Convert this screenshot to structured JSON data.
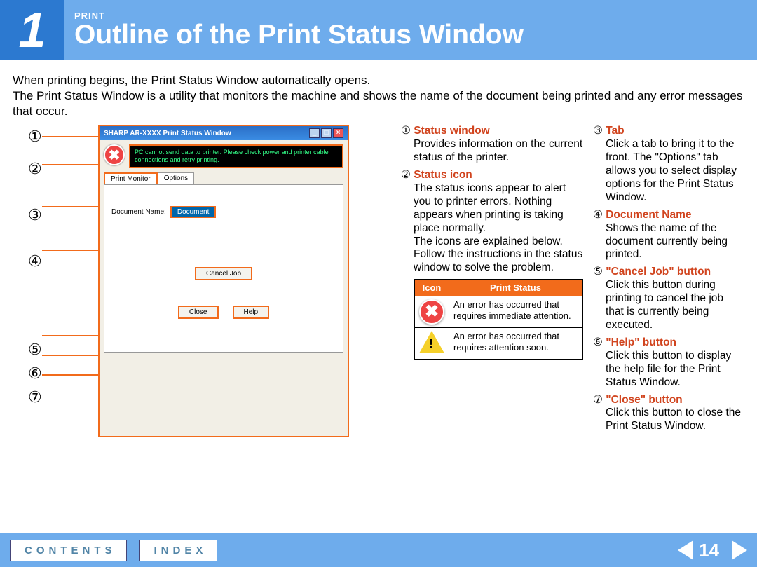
{
  "header": {
    "number": "1",
    "category": "PRINT",
    "title": "Outline of the Print Status Window"
  },
  "intro": "When printing begins, the Print Status Window automatically opens.\nThe Print Status Window is a utility that monitors the machine and shows the name of the document being printed and any error messages that occur.",
  "figure": {
    "windowTitle": "SHARP AR-XXXX Print Status Window",
    "errorMsg": "PC cannot send data to printer. Please check power and printer cable connections and retry printing.",
    "tab1": "Print Monitor",
    "tab2": "Options",
    "docLabel": "Document Name:",
    "docValue": "Document",
    "cancelBtn": "Cancel Job",
    "closeBtn": "Close",
    "helpBtn": "Help"
  },
  "callouts": [
    "①",
    "②",
    "③",
    "④",
    "⑤",
    "⑥",
    "⑦"
  ],
  "items": [
    {
      "num": "①",
      "title": "Status window",
      "desc": "Provides information on the current status of the printer."
    },
    {
      "num": "②",
      "title": "Status icon",
      "desc": "The status icons appear to alert you to printer errors. Nothing appears when printing is taking place normally.\nThe icons are explained below. Follow the instructions in the status window to solve the problem."
    },
    {
      "num": "③",
      "title": "Tab",
      "desc": "Click a tab to bring it to the front. The \"Options\" tab allows you to select display options for the Print Status Window."
    },
    {
      "num": "④",
      "title": "Document Name",
      "desc": "Shows the name of the document currently being printed."
    },
    {
      "num": "⑤",
      "title": "\"Cancel Job\" button",
      "desc": "Click this button during printing to cancel the job that is currently being executed."
    },
    {
      "num": "⑥",
      "title": "\"Help\" button",
      "desc": "Click this button to display the help file for the Print Status Window."
    },
    {
      "num": "⑦",
      "title": "\"Close\" button",
      "desc": "Click this button to close the Print Status Window."
    }
  ],
  "iconTable": {
    "hIcon": "Icon",
    "hStatus": "Print Status",
    "row1": "An error has occurred that requires immediate attention.",
    "row2": "An error has occurred that requires attention soon."
  },
  "footer": {
    "contents": "CONTENTS",
    "index": "INDEX",
    "page": "14"
  }
}
